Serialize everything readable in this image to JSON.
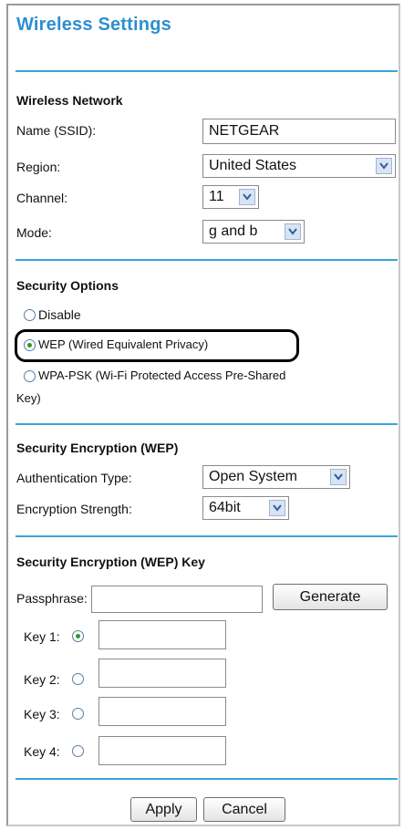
{
  "page": {
    "title": "Wireless Settings"
  },
  "wireless_network": {
    "heading": "Wireless Network",
    "ssid_label": "Name (SSID):",
    "ssid_value": "NETGEAR",
    "region_label": "Region:",
    "region_value": "United States",
    "channel_label": "Channel:",
    "channel_value": "11",
    "mode_label": "Mode:",
    "mode_value": "g and b"
  },
  "security_options": {
    "heading": "Security Options",
    "disable_label": "Disable",
    "wep_label": "WEP (Wired Equivalent Privacy)",
    "wpa_label_line1": "WPA-PSK (Wi-Fi Protected Access Pre-Shared",
    "wpa_label_line2": "Key)",
    "selected": "WEP"
  },
  "encryption": {
    "heading": "Security Encryption (WEP)",
    "auth_label": "Authentication Type:",
    "auth_value": "Open System",
    "strength_label": "Encryption Strength:",
    "strength_value": "64bit"
  },
  "wep_key": {
    "heading": "Security Encryption (WEP) Key",
    "passphrase_label": "Passphrase:",
    "passphrase_value": "",
    "generate_label": "Generate",
    "keys": [
      {
        "label": "Key 1:",
        "value": "",
        "selected": true
      },
      {
        "label": "Key 2:",
        "value": "",
        "selected": false
      },
      {
        "label": "Key 3:",
        "value": "",
        "selected": false
      },
      {
        "label": "Key 4:",
        "value": "",
        "selected": false
      }
    ]
  },
  "actions": {
    "apply_label": "Apply",
    "cancel_label": "Cancel"
  },
  "colors": {
    "accent": "#2d8fd0",
    "rule": "#3aa4d6",
    "radio_checked": "#2a9a2a"
  },
  "icons": {
    "dropdown": "chevron-down-icon"
  }
}
